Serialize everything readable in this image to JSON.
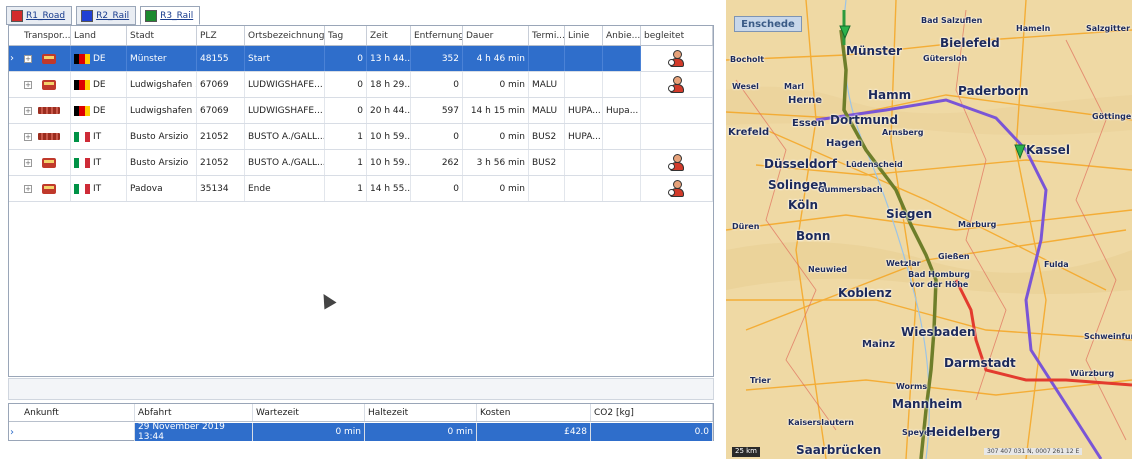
{
  "tabs": [
    {
      "label": "R1_Road",
      "color": "#d22b2b"
    },
    {
      "label": "R2_Rail",
      "color": "#1f3fd4"
    },
    {
      "label": "R3_Rail",
      "color": "#1d8a2e"
    }
  ],
  "grid": {
    "headers": [
      "Transpor...",
      "Land",
      "Stadt",
      "PLZ",
      "Ortsbezeichnung",
      "Tag",
      "Zeit",
      "Entfernung",
      "Dauer",
      "Termi...",
      "Linie",
      "Anbie...",
      "begleitet"
    ],
    "rows": [
      {
        "mode": "truck",
        "country_code": "DE",
        "flag": "de",
        "city": "Münster",
        "plz": "48155",
        "place": "Start",
        "day": "0",
        "time": "13 h 44...",
        "distance": "352",
        "duration": "4 h 46 min",
        "terminal": "",
        "line": "",
        "provider": "",
        "escorted": true,
        "selected": true
      },
      {
        "mode": "truck",
        "country_code": "DE",
        "flag": "de",
        "city": "Ludwigshafen ...",
        "plz": "67069",
        "place": "LUDWIGSHAFE...",
        "day": "0",
        "time": "18 h 29...",
        "distance": "0",
        "duration": "0 min",
        "terminal": "MALU",
        "line": "",
        "provider": "",
        "escorted": true,
        "selected": false
      },
      {
        "mode": "train",
        "country_code": "DE",
        "flag": "de",
        "city": "Ludwigshafen ...",
        "plz": "67069",
        "place": "LUDWIGSHAFE...",
        "day": "0",
        "time": "20 h 44...",
        "distance": "597",
        "duration": "14 h 15 min",
        "terminal": "MALU",
        "line": "HUPA...",
        "provider": "Hupa...",
        "escorted": false,
        "selected": false
      },
      {
        "mode": "train",
        "country_code": "IT",
        "flag": "it",
        "city": "Busto Arsizio",
        "plz": "21052",
        "place": "BUSTO A./GALL...",
        "day": "1",
        "time": "10 h 59...",
        "distance": "0",
        "duration": "0 min",
        "terminal": "BUS2",
        "line": "HUPA...",
        "provider": "",
        "escorted": false,
        "selected": false
      },
      {
        "mode": "truck",
        "country_code": "IT",
        "flag": "it",
        "city": "Busto Arsizio",
        "plz": "21052",
        "place": "BUSTO A./GALL...",
        "day": "1",
        "time": "10 h 59...",
        "distance": "262",
        "duration": "3 h 56 min",
        "terminal": "BUS2",
        "line": "",
        "provider": "",
        "escorted": true,
        "selected": false
      },
      {
        "mode": "truck",
        "country_code": "IT",
        "flag": "it",
        "city": "Padova",
        "plz": "35134",
        "place": "Ende",
        "day": "1",
        "time": "14 h 55...",
        "distance": "0",
        "duration": "0 min",
        "terminal": "",
        "line": "",
        "provider": "",
        "escorted": true,
        "selected": false
      }
    ]
  },
  "summary": {
    "headers": [
      "Ankunft",
      "Abfahrt",
      "Wartezeit",
      "Haltezeit",
      "Kosten",
      "CO2 [kg]"
    ],
    "values": [
      "",
      "29 November 2019 13:44",
      "0 min",
      "0 min",
      "£428",
      "0.0"
    ]
  },
  "map": {
    "overview_label": "Enschede",
    "cities": [
      {
        "name": "Bad Salzuflen",
        "size": "s"
      },
      {
        "name": "Hameln",
        "size": "s"
      },
      {
        "name": "Salzgitter",
        "size": "s"
      },
      {
        "name": "Münster",
        "size": "l"
      },
      {
        "name": "Bielefeld",
        "size": "l"
      },
      {
        "name": "Gütersloh",
        "size": "s"
      },
      {
        "name": "Bocholt",
        "size": "s"
      },
      {
        "name": "Wesel",
        "size": "s"
      },
      {
        "name": "Marl",
        "size": "s"
      },
      {
        "name": "Herne",
        "size": "m"
      },
      {
        "name": "Hamm",
        "size": "l"
      },
      {
        "name": "Paderborn",
        "size": "l"
      },
      {
        "name": "Göttingen",
        "size": "s"
      },
      {
        "name": "Essen",
        "size": "m"
      },
      {
        "name": "Dortmund",
        "size": "l"
      },
      {
        "name": "Arnsberg",
        "size": "s"
      },
      {
        "name": "Krefeld",
        "size": "m"
      },
      {
        "name": "Hagen",
        "size": "m"
      },
      {
        "name": "Kassel",
        "size": "l"
      },
      {
        "name": "Düsseldorf",
        "size": "l"
      },
      {
        "name": "Lüdenscheid",
        "size": "s"
      },
      {
        "name": "Solingen",
        "size": "l"
      },
      {
        "name": "Gummersbach",
        "size": "s"
      },
      {
        "name": "Köln",
        "size": "l"
      },
      {
        "name": "Siegen",
        "size": "l"
      },
      {
        "name": "Düren",
        "size": "s"
      },
      {
        "name": "Marburg",
        "size": "s"
      },
      {
        "name": "Bonn",
        "size": "l"
      },
      {
        "name": "Gießen",
        "size": "s"
      },
      {
        "name": "Wetzlar",
        "size": "s"
      },
      {
        "name": "Fulda",
        "size": "s"
      },
      {
        "name": "Neuwied",
        "size": "s"
      },
      {
        "name": "Bad Homburg vor der Höhe",
        "size": "s"
      },
      {
        "name": "Koblenz",
        "size": "l"
      },
      {
        "name": "Wiesbaden",
        "size": "l"
      },
      {
        "name": "Mainz",
        "size": "m"
      },
      {
        "name": "Schweinfurt",
        "size": "s"
      },
      {
        "name": "Darmstadt",
        "size": "l"
      },
      {
        "name": "Würzburg",
        "size": "s"
      },
      {
        "name": "Trier",
        "size": "s"
      },
      {
        "name": "Worms",
        "size": "s"
      },
      {
        "name": "Mannheim",
        "size": "l"
      },
      {
        "name": "Kaiserslautern",
        "size": "s"
      },
      {
        "name": "Speyer",
        "size": "s"
      },
      {
        "name": "Heidelberg",
        "size": "l"
      },
      {
        "name": "Saarbrücken",
        "size": "l"
      }
    ],
    "scale_label": "25 km",
    "coords_label": "307 407 031 N, 0007 261 12 E"
  },
  "colors": {
    "selection": "#2f6ecb",
    "route_road": "#e33b2e",
    "route_rail_blue": "#7a55d6",
    "route_rail_green": "#6e7e2a",
    "map_bg": "#f0dba8"
  }
}
